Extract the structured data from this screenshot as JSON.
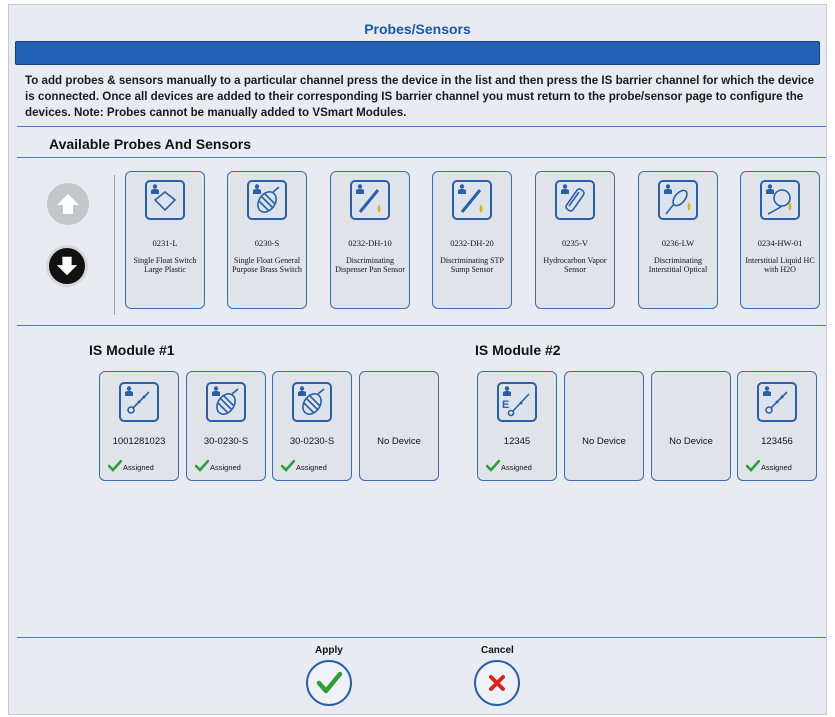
{
  "window": {
    "title": "Probes/Sensors"
  },
  "instructions": "To add probes & sensors manually to a particular channel press the device in the list and then press the IS barrier channel for which the device is connected.  Once all devices are added to their corresponding IS barrier channel you must return to the probe/sensor page to configure the devices.  Note: Probes cannot be manually added to VSmart Modules.",
  "available": {
    "heading": "Available Probes And Sensors",
    "items": [
      {
        "code": "0231-L",
        "desc": "Single Float Switch Large Plastic",
        "icon": "float-switch-icon"
      },
      {
        "code": "0230-S",
        "desc": "Single Float General Purpose Brass Switch",
        "icon": "brass-float-icon"
      },
      {
        "code": "0232-DH-10",
        "desc": "Discriminating Dispenser Pan Sensor",
        "icon": "dispenser-pan-sensor-icon"
      },
      {
        "code": "0232-DH-20",
        "desc": "Discriminating STP Sump Sensor",
        "icon": "sump-sensor-icon"
      },
      {
        "code": "0235-V",
        "desc": "Hydrocarbon Vapor Sensor",
        "icon": "vapor-sensor-icon"
      },
      {
        "code": "0236-LW",
        "desc": "Discriminating Interstitial Optical",
        "icon": "optical-sensor-icon"
      },
      {
        "code": "0234-HW-01",
        "desc": "Interstitial Liquid HC with H2O",
        "icon": "liquid-sensor-icon"
      }
    ]
  },
  "modules": [
    {
      "title": "IS Module #1",
      "slots": [
        {
          "label": "1001281023",
          "status": "Assigned",
          "icon": "probe-icon"
        },
        {
          "label": "30-0230-S",
          "status": "Assigned",
          "icon": "brass-float-icon"
        },
        {
          "label": "30-0230-S",
          "status": "Assigned",
          "icon": "brass-float-icon"
        },
        {
          "label": "No Device",
          "status": "",
          "icon": ""
        }
      ]
    },
    {
      "title": "IS Module #2",
      "slots": [
        {
          "label": "12345",
          "status": "Assigned",
          "icon": "probe-e-icon"
        },
        {
          "label": "No Device",
          "status": "",
          "icon": ""
        },
        {
          "label": "No Device",
          "status": "",
          "icon": ""
        },
        {
          "label": "123456",
          "status": "Assigned",
          "icon": "probe-icon"
        }
      ]
    }
  ],
  "buttons": {
    "apply": "Apply",
    "cancel": "Cancel"
  },
  "colors": {
    "accent": "#2261b3",
    "check": "#2e9e3a",
    "cancel": "#d9261c"
  }
}
